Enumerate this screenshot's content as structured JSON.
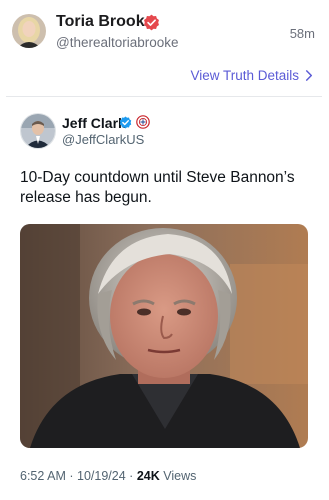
{
  "post": {
    "display_name": "Toria Brooke",
    "handle": "@therealtoriabrooke",
    "time_ago": "58m",
    "view_details_label": "View Truth Details"
  },
  "embedded_tweet": {
    "display_name": "Jeff Clark",
    "handle": "@JeffClarkUS",
    "text": "10-Day countdown until Steve Bannon’s release has begun.",
    "time": "6:52 AM",
    "date": "10/19/24",
    "views_count": "24K",
    "views_label": "Views"
  },
  "colors": {
    "truth_badge": "#e5484d",
    "link": "#5b5bd6",
    "twitter_verified": "#1d9bf0"
  }
}
